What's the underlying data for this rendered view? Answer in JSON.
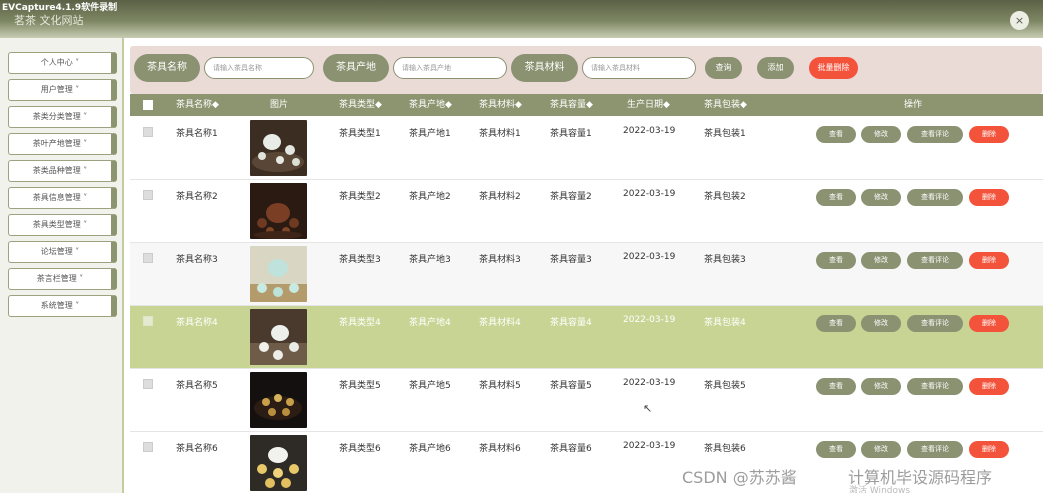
{
  "capture_title": "EVCapture4.1.9软件录制",
  "site_title": "茗茶 文化网站",
  "close_icon": "×",
  "sidebar": {
    "items": [
      {
        "label": "个人中心 ˅"
      },
      {
        "label": "用户管理 ˅"
      },
      {
        "label": "茶类分类管理 ˅"
      },
      {
        "label": "茶叶产地管理 ˅"
      },
      {
        "label": "茶类品种管理 ˅"
      },
      {
        "label": "茶具信息管理 ˅"
      },
      {
        "label": "茶具类型管理 ˅"
      },
      {
        "label": "论坛管理 ˅"
      },
      {
        "label": "茶言栏管理 ˅"
      },
      {
        "label": "系统管理 ˅"
      }
    ]
  },
  "search": {
    "name_label": "茶具名称",
    "name_placeholder": "请输入茶具名称",
    "origin_label": "茶具产地",
    "origin_placeholder": "请输入茶具产地",
    "material_label": "茶具材料",
    "material_placeholder": "请输入茶具材料",
    "query_label": "查询",
    "add_label": "添加",
    "batch_delete_label": "批量删除"
  },
  "table": {
    "headers": [
      "茶具名称◆",
      "图片",
      "茶具类型◆",
      "茶具产地◆",
      "茶具材料◆",
      "茶具容量◆",
      "生产日期◆",
      "茶具包装◆",
      "操作"
    ],
    "rows": [
      {
        "name": "茶具名称1",
        "type": "茶具类型1",
        "origin": "茶具产地1",
        "material": "茶具材料1",
        "capacity": "茶具容量1",
        "date": "2022-03-19",
        "pack": "茶具包装1"
      },
      {
        "name": "茶具名称2",
        "type": "茶具类型2",
        "origin": "茶具产地2",
        "material": "茶具材料2",
        "capacity": "茶具容量2",
        "date": "2022-03-19",
        "pack": "茶具包装2"
      },
      {
        "name": "茶具名称3",
        "type": "茶具类型3",
        "origin": "茶具产地3",
        "material": "茶具材料3",
        "capacity": "茶具容量3",
        "date": "2022-03-19",
        "pack": "茶具包装3"
      },
      {
        "name": "茶具名称4",
        "type": "茶具类型4",
        "origin": "茶具产地4",
        "material": "茶具材料4",
        "capacity": "茶具容量4",
        "date": "2022-03-19",
        "pack": "茶具包装4"
      },
      {
        "name": "茶具名称5",
        "type": "茶具类型5",
        "origin": "茶具产地5",
        "material": "茶具材料5",
        "capacity": "茶具容量5",
        "date": "2022-03-19",
        "pack": "茶具包装5"
      },
      {
        "name": "茶具名称6",
        "type": "茶具类型6",
        "origin": "茶具产地6",
        "material": "茶具材料6",
        "capacity": "茶具容量6",
        "date": "2022-03-19",
        "pack": "茶具包装6"
      }
    ],
    "actions": {
      "view": "查看",
      "edit": "修改",
      "comments": "查看评论",
      "delete": "删除"
    }
  },
  "watermark": {
    "csdn": "CSDN @苏苏酱",
    "author": "计算机毕设源码程序",
    "windows": "激活 Windows"
  },
  "colors": {
    "accent": "#8b9272",
    "danger": "#f4533b",
    "highlight_row": "#c8d494",
    "search_bg": "#eadbd7"
  }
}
